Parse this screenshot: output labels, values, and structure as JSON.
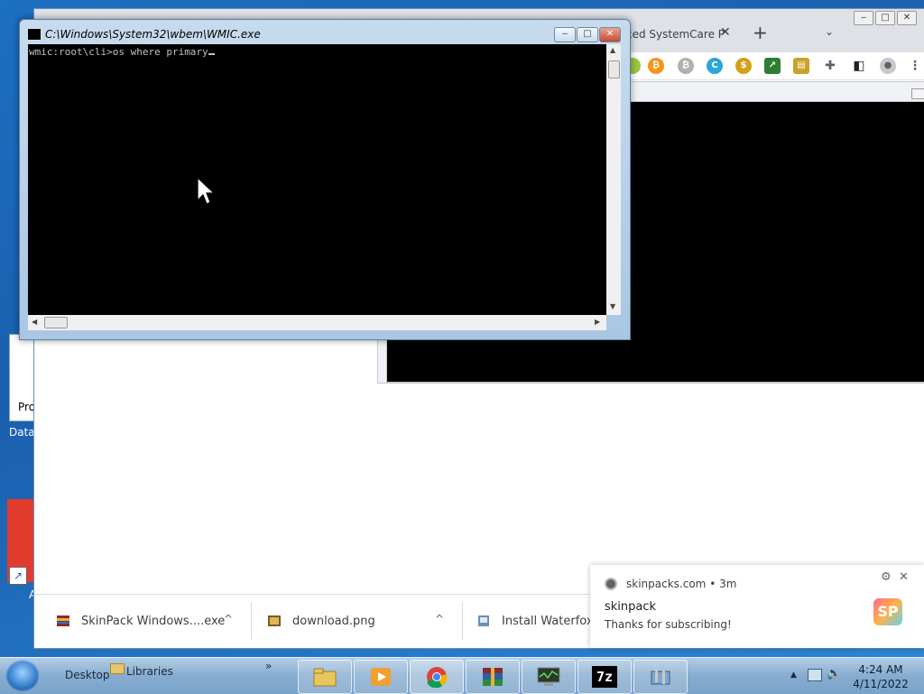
{
  "cmd_window": {
    "title": "C:\\Windows\\System32\\wbem\\WMIC.exe",
    "prompt": "wmic:root\\cli>",
    "command": "os where primary",
    "minimize": "‒",
    "maximize": "□",
    "close": "✕"
  },
  "browser": {
    "tab_title": "ced SystemCare P",
    "tab_close": "✕",
    "new_tab": "+",
    "tab_menu": "⌄"
  },
  "desktop_fragments": {
    "pro_label": "Pro",
    "data_label": "Data\\",
    "a_label": "A"
  },
  "downloads": [
    {
      "name": "SkinPack Windows....exe",
      "icon": "installer-icon",
      "caret": "^"
    },
    {
      "name": "download.png",
      "icon": "image-file-icon",
      "caret": "^"
    },
    {
      "name": "Install Waterfox.e",
      "icon": "installer-icon",
      "caret": ""
    }
  ],
  "download_bar_close": "✕",
  "notification": {
    "source": "skinpacks.com",
    "time": "3m",
    "separator": "•",
    "title": "skinpack",
    "message": "Thanks for subscribing!",
    "logo_text": "SP",
    "settings": "⚙",
    "close": "✕"
  },
  "taskbar": {
    "desktop_label": "Desktop",
    "libraries_label": "Libraries",
    "overflow": "»",
    "time": "4:24 AM",
    "date": "4/11/2022",
    "apps": [
      "file-explorer-icon",
      "media-player-icon",
      "chrome-icon",
      "winrar-icon",
      "monitor-app-icon",
      "7zip-icon",
      "control-panel-icon"
    ],
    "seven_zip_label": "7z"
  },
  "colors": {
    "console_bg": "#000000",
    "console_text": "#c0c0c0",
    "taskbar": "#86acd0",
    "desktop": "#1c6fc1"
  }
}
